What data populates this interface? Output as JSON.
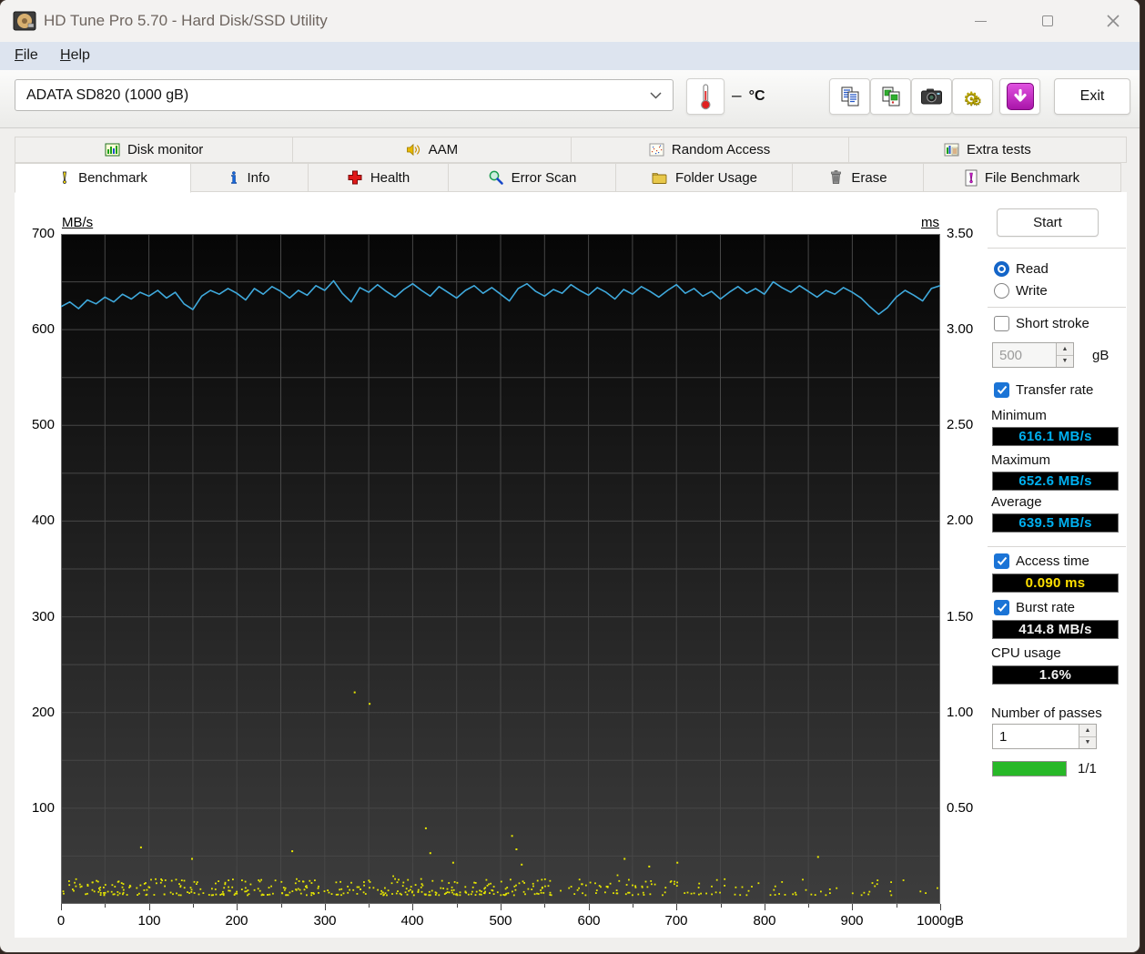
{
  "window": {
    "title": "HD Tune Pro 5.70 - Hard Disk/SSD Utility"
  },
  "menu": {
    "items": [
      {
        "label": "File"
      },
      {
        "label": "Help"
      }
    ]
  },
  "toolbar": {
    "drive_select": "ADATA   SD820 (1000 gB)",
    "temperature": {
      "value": "–",
      "unit": "°C"
    },
    "exit_label": "Exit"
  },
  "tabs": {
    "row1": [
      {
        "label": "Disk monitor"
      },
      {
        "label": "AAM"
      },
      {
        "label": "Random Access"
      },
      {
        "label": "Extra tests"
      }
    ],
    "row2": [
      {
        "label": "Benchmark",
        "active": true
      },
      {
        "label": "Info"
      },
      {
        "label": "Health"
      },
      {
        "label": "Error Scan"
      },
      {
        "label": "Folder Usage"
      },
      {
        "label": "Erase"
      },
      {
        "label": "File Benchmark"
      }
    ]
  },
  "panel": {
    "start_label": "Start",
    "read_label": "Read",
    "write_label": "Write",
    "short_stroke_label": "Short stroke",
    "short_stroke_value": "500",
    "short_stroke_unit": "gB",
    "transfer_rate_label": "Transfer rate",
    "minimum_label": "Minimum",
    "minimum_value": "616.1 MB/s",
    "maximum_label": "Maximum",
    "maximum_value": "652.6 MB/s",
    "average_label": "Average",
    "average_value": "639.5 MB/s",
    "access_time_label": "Access time",
    "access_time_value": "0.090 ms",
    "burst_rate_label": "Burst rate",
    "burst_rate_value": "414.8 MB/s",
    "cpu_usage_label": "CPU usage",
    "cpu_usage_value": "1.6%",
    "passes_label": "Number of passes",
    "passes_value": "1",
    "passes_progress_text": "1/1",
    "passes_progress_percent": 100
  },
  "colors": {
    "line": "#3fa9dc",
    "dots": "#e6e600",
    "grid": "#474747",
    "plot_border": "#6b6b6b",
    "plot_bg_top": "#060606",
    "plot_bg_bottom": "#3d3d3d",
    "value_cyan": "#00b0f0",
    "value_yellow": "#ffe000",
    "progress_green": "#28b828",
    "download_purple": "#b820b8"
  },
  "chart_data": {
    "type": "line",
    "x_unit_label": "gB",
    "y_left_unit_label": "MB/s",
    "y_right_unit_label": "ms",
    "x_range": [
      0,
      1000
    ],
    "y_left_range": [
      0,
      700
    ],
    "y_right_range": [
      0,
      3.5
    ],
    "grid_step_x": 50,
    "grid_step_y_left": 50,
    "x_tick_labels": [
      "0",
      "100",
      "200",
      "300",
      "400",
      "500",
      "600",
      "700",
      "800",
      "900",
      "1000gB"
    ],
    "y_left_tick_labels": [
      "700",
      "600",
      "500",
      "400",
      "300",
      "200",
      "100"
    ],
    "y_right_tick_labels": [
      "3.50",
      "3.00",
      "2.50",
      "2.00",
      "1.50",
      "1.00",
      "0.50"
    ],
    "series": [
      {
        "name": "read-transfer-rate",
        "axis": "left",
        "kind": "line",
        "x_step_gB": 10,
        "values_mbps": [
          624,
          629,
          622,
          631,
          627,
          634,
          629,
          637,
          632,
          639,
          635,
          641,
          633,
          639,
          627,
          621,
          635,
          641,
          637,
          643,
          638,
          631,
          643,
          637,
          645,
          640,
          633,
          641,
          636,
          646,
          641,
          651,
          638,
          629,
          644,
          639,
          647,
          640,
          634,
          642,
          648,
          641,
          635,
          645,
          639,
          633,
          641,
          646,
          638,
          644,
          637,
          630,
          643,
          648,
          640,
          635,
          642,
          638,
          647,
          641,
          636,
          644,
          639,
          632,
          642,
          637,
          645,
          640,
          634,
          641,
          647,
          638,
          643,
          635,
          640,
          632,
          639,
          645,
          638,
          643,
          637,
          650,
          644,
          639,
          646,
          640,
          634,
          641,
          637,
          644,
          639,
          633,
          624,
          616,
          623,
          634,
          641,
          636,
          630,
          643,
          646
        ]
      },
      {
        "name": "access-time-dots",
        "axis": "right",
        "kind": "scatter",
        "outliers_gb_ms": [
          [
            333,
            1.11
          ],
          [
            350,
            1.05
          ],
          [
            90,
            0.3
          ],
          [
            148,
            0.24
          ],
          [
            262,
            0.28
          ],
          [
            414,
            0.4
          ],
          [
            419,
            0.27
          ],
          [
            445,
            0.22
          ],
          [
            512,
            0.36
          ],
          [
            517,
            0.29
          ],
          [
            523,
            0.21
          ],
          [
            640,
            0.24
          ],
          [
            668,
            0.2
          ],
          [
            700,
            0.22
          ],
          [
            860,
            0.25
          ]
        ],
        "band": {
          "count": 680,
          "seed": 42,
          "ms_min": 0.05,
          "ms_max": 0.135,
          "note": "dense access-time band near 0.09 ms, density thins toward high addresses"
        }
      }
    ]
  }
}
